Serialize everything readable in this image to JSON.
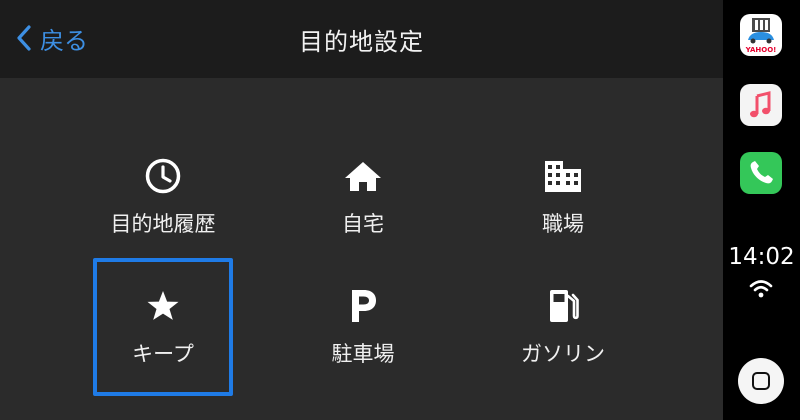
{
  "header": {
    "back_label": "戻る",
    "title": "目的地設定"
  },
  "destinations": [
    {
      "label": "目的地履歴",
      "icon": "clock-icon"
    },
    {
      "label": "自宅",
      "icon": "home-icon"
    },
    {
      "label": "職場",
      "icon": "office-building-icon"
    },
    {
      "label": "キープ",
      "icon": "star-icon",
      "selected": true
    },
    {
      "label": "駐車場",
      "icon": "parking-icon"
    },
    {
      "label": "ガソリン",
      "icon": "gas-station-icon"
    }
  ],
  "dock": {
    "apps": [
      {
        "name": "Yahoo! Car Navi",
        "icon": "yahoo-carnavi-icon",
        "logo_text": "YAHOO!"
      },
      {
        "name": "Music",
        "icon": "music-icon"
      },
      {
        "name": "Phone",
        "icon": "phone-icon"
      }
    ],
    "time": "14:02",
    "status_icon": "wifi-icon",
    "home_icon": "home-button-icon"
  },
  "colors": {
    "accent": "#1f7be6",
    "back_text": "#3d8fe3",
    "background": "#2b2b2b",
    "header": "#1c1c1c"
  }
}
